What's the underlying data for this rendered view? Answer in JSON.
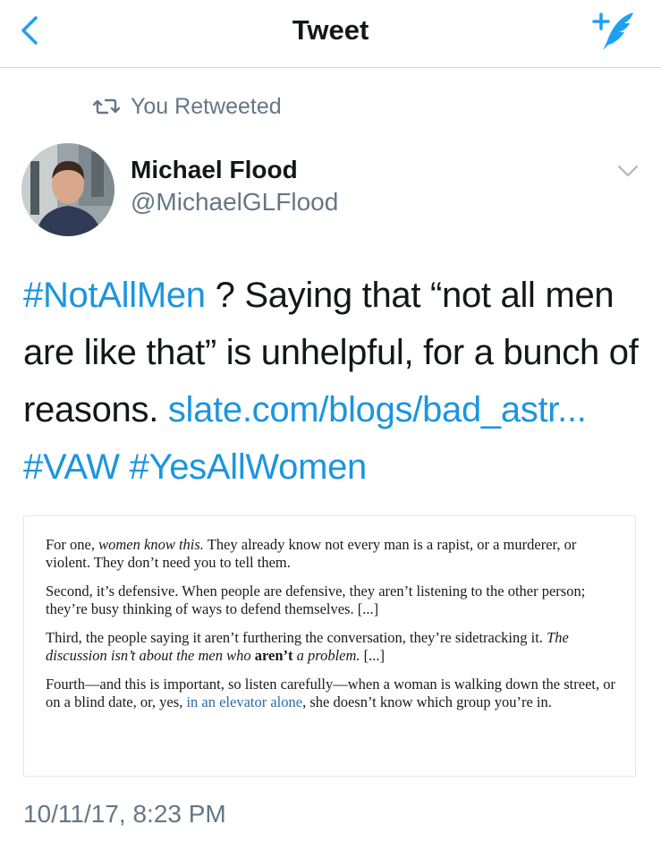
{
  "navbar": {
    "title": "Tweet",
    "back_icon": "chevron-left-icon",
    "compose_icon": "compose-tweet-icon",
    "accent_color": "#1da1f2"
  },
  "retweet": {
    "icon": "retweet-icon",
    "label": "You Retweeted"
  },
  "author": {
    "display_name": "Michael Flood",
    "handle": "@MichaelGLFlood",
    "avatar_icon": "avatar"
  },
  "tweet": {
    "parts": [
      {
        "text": "#NotAllMen",
        "link": true
      },
      {
        "text": " ? Saying that “not all men are like that” is unhelpful, for a bunch of reasons. ",
        "link": false
      },
      {
        "text": "slate.com/blogs/bad_astr...",
        "link": true
      },
      {
        "text": " ",
        "link": false
      },
      {
        "text": "#VAW",
        "link": true
      },
      {
        "text": " ",
        "link": false
      },
      {
        "text": "#YesAllWomen",
        "link": true
      }
    ],
    "link_color": "#1b95e0"
  },
  "quote_image": {
    "p1_a": "For one, ",
    "p1_em": "women know this.",
    "p1_b": " They already know not every man is a rapist, or a murderer, or violent. They don’t need you to tell them.",
    "p2": "Second, it’s defensive. When people are defensive, they aren’t listening to the other person; they’re busy thinking of ways to defend themselves. [...]",
    "p3_a": "Third, the people saying it aren’t furthering the conversation, they’re sidetracking it. ",
    "p3_em_a": "The discussion isn’t about the men who ",
    "p3_strong": "aren’t",
    "p3_em_b": " a problem.",
    "p3_c": " [...]",
    "p4_a": "Fourth—and this is important, so listen carefully—when a woman is walking down the street, or on a blind date, or, yes, ",
    "p4_link": "in an elevator alone",
    "p4_b": ", she doesn’t know which group you’re in."
  },
  "timestamp": "10/11/17, 8:23 PM"
}
